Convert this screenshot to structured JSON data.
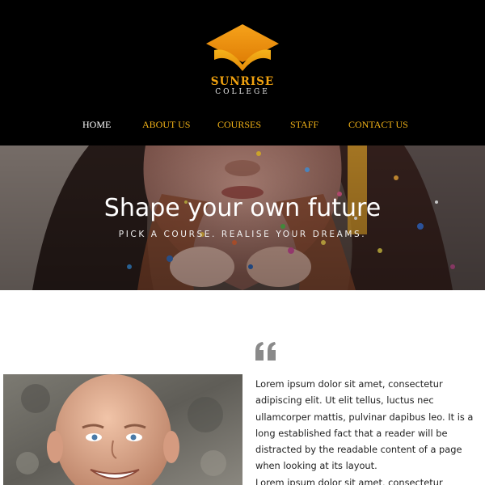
{
  "brand": {
    "name": "SUNRISE",
    "subname": "COLLEGE",
    "logo_icon": "graduation-cap-icon",
    "colors": {
      "accent": "#f2a30f",
      "header_bg": "#000000"
    }
  },
  "nav": {
    "items": [
      {
        "label": "HOME",
        "active": true
      },
      {
        "label": "ABOUT US",
        "active": false
      },
      {
        "label": "COURSES",
        "active": false
      },
      {
        "label": "STAFF",
        "active": false
      },
      {
        "label": "CONTACT US",
        "active": false
      }
    ]
  },
  "hero": {
    "title": "Shape your own future",
    "subtitle": "PICK A COURSE. REALISE YOUR DREAMS."
  },
  "testimonial": {
    "quote_icon": "quote-icon",
    "paragraphs": [
      "Lorem ipsum dolor sit amet, consectetur adipiscing elit. Ut elit tellus, luctus nec ullamcorper mattis, pulvinar dapibus leo. It is a long established fact that a reader will be distracted by the readable content of a page when looking at its layout.",
      "Lorem ipsum dolor sit amet, consectetur adipiscing"
    ]
  }
}
